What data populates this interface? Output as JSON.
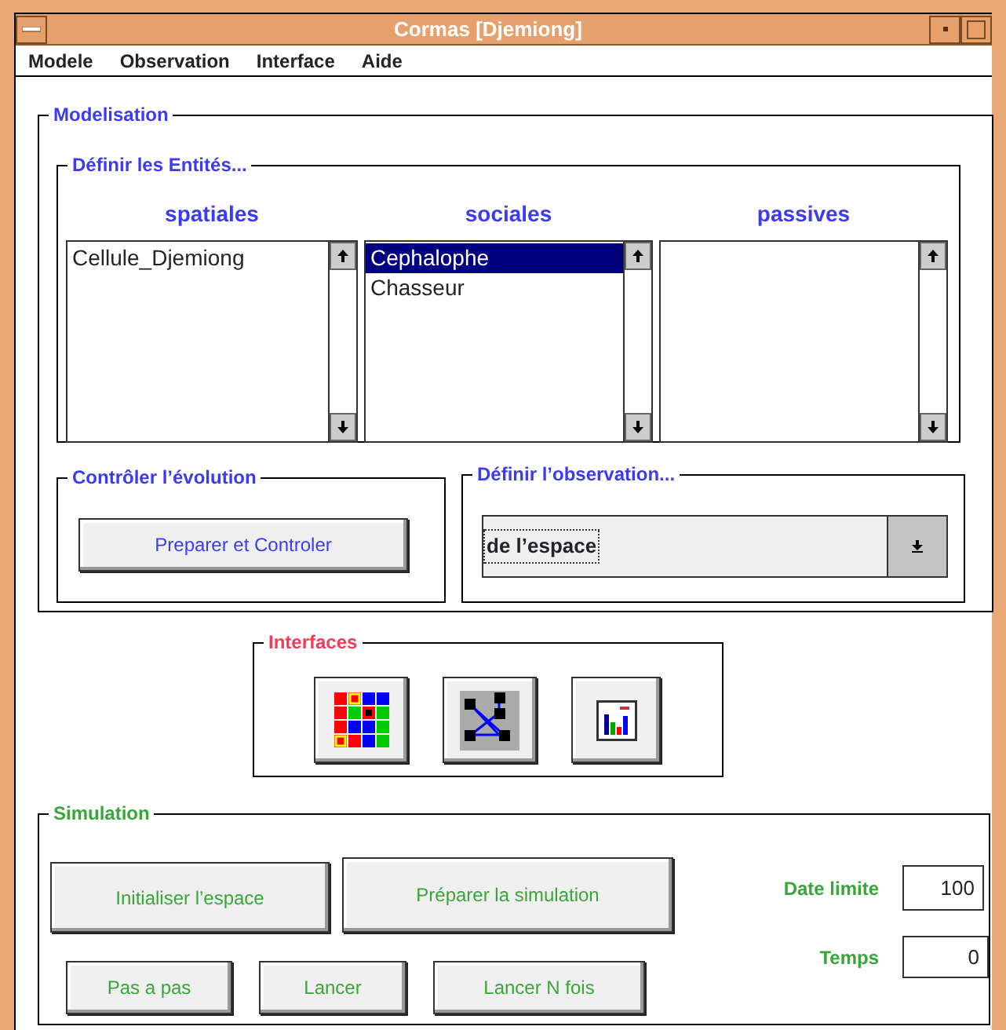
{
  "window": {
    "title": "Cormas [Djemiong]"
  },
  "menu": [
    {
      "label": "Modele"
    },
    {
      "label": "Observation"
    },
    {
      "label": "Interface"
    },
    {
      "label": "Aide"
    }
  ],
  "modelisation": {
    "title": "Modelisation",
    "entities": {
      "title": "Définir les Entités...",
      "lists": [
        {
          "heading": "spatiales",
          "items": [
            {
              "label": "Cellule_Djemiong",
              "selected": false
            }
          ]
        },
        {
          "heading": "sociales",
          "items": [
            {
              "label": "Cephalophe",
              "selected": true
            },
            {
              "label": "Chasseur",
              "selected": false
            }
          ]
        },
        {
          "heading": "passives"
        }
      ]
    },
    "control": {
      "title": "Contrôler l’évolution",
      "button": "Preparer et Controler"
    },
    "observation": {
      "title": "Définir l’observation...",
      "value": "de l’espace"
    }
  },
  "interfaces": {
    "title": "Interfaces",
    "buttons": [
      {
        "kind": "grid"
      },
      {
        "kind": "network"
      },
      {
        "kind": "chart"
      }
    ]
  },
  "simulation": {
    "title": "Simulation",
    "top_buttons": [
      "Initialiser l’espace",
      "Préparer la simulation"
    ],
    "bottom_buttons": [
      "Pas a pas",
      "Lancer",
      "Lancer N fois"
    ],
    "fields": [
      {
        "label": "Date limite",
        "value": "100"
      },
      {
        "label": "Temps",
        "value": "0"
      }
    ]
  }
}
